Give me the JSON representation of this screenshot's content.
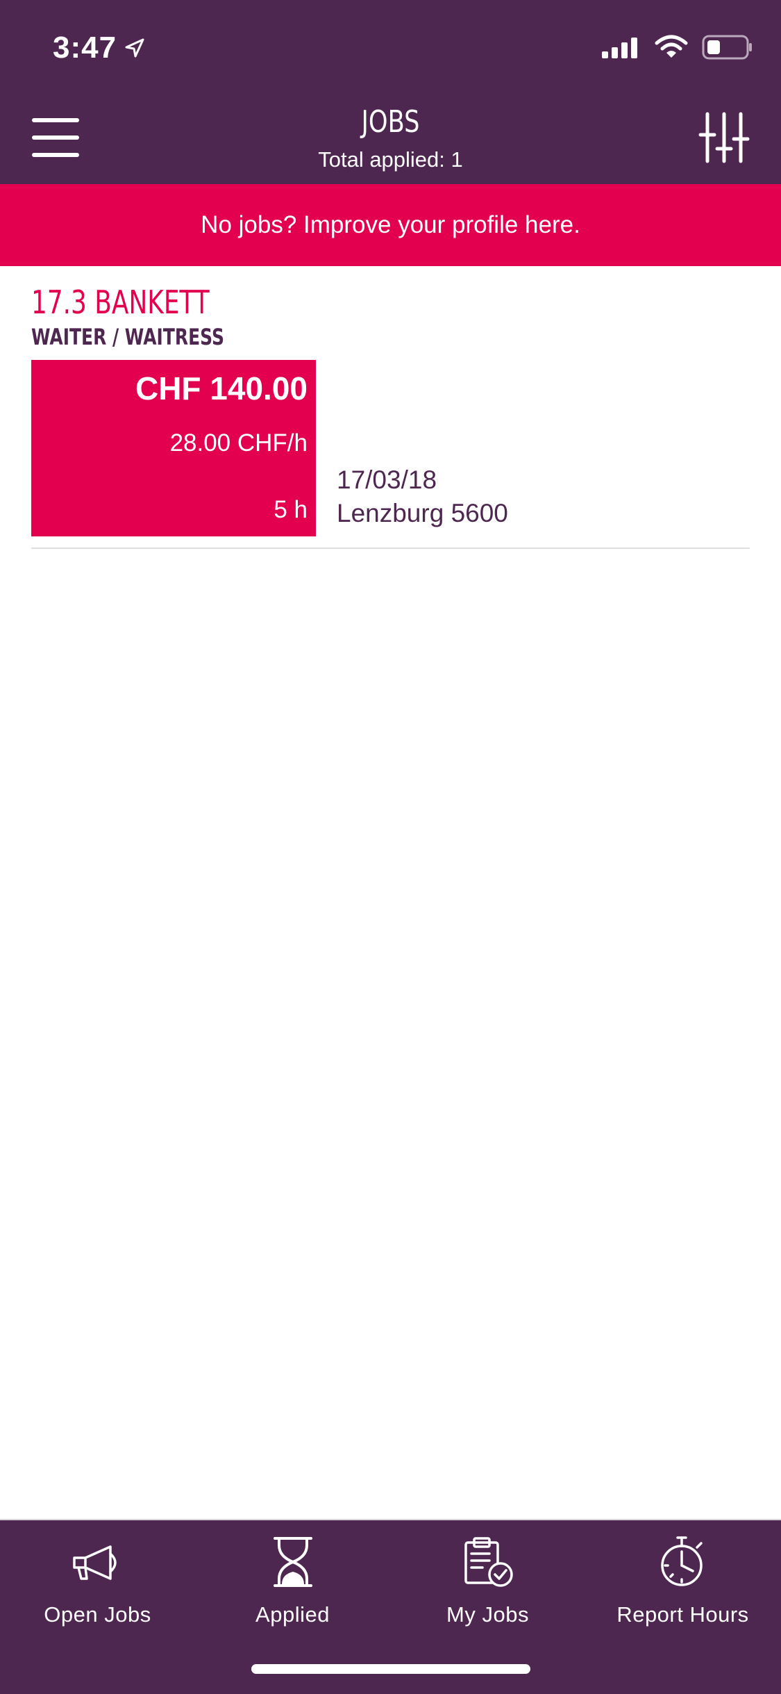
{
  "status_bar": {
    "time": "3:47"
  },
  "header": {
    "title": "JOBS",
    "subtitle": "Total applied: 1"
  },
  "banner": {
    "text": "No jobs? Improve your profile here."
  },
  "jobs": [
    {
      "title": "17.3 BANKETT",
      "role": "WAITER / WAITRESS",
      "total": "CHF 140.00",
      "rate": "28.00 CHF/h",
      "hours": "5 h",
      "date": "17/03/18",
      "location": "Lenzburg 5600"
    }
  ],
  "bottom_nav": {
    "items": [
      {
        "label": "Open Jobs",
        "icon": "megaphone-icon"
      },
      {
        "label": "Applied",
        "icon": "hourglass-icon"
      },
      {
        "label": "My Jobs",
        "icon": "clipboard-check-icon"
      },
      {
        "label": "Report Hours",
        "icon": "stopwatch-icon"
      }
    ]
  },
  "colors": {
    "primary": "#4e2750",
    "accent": "#e2004f",
    "background": "#ffffff"
  }
}
